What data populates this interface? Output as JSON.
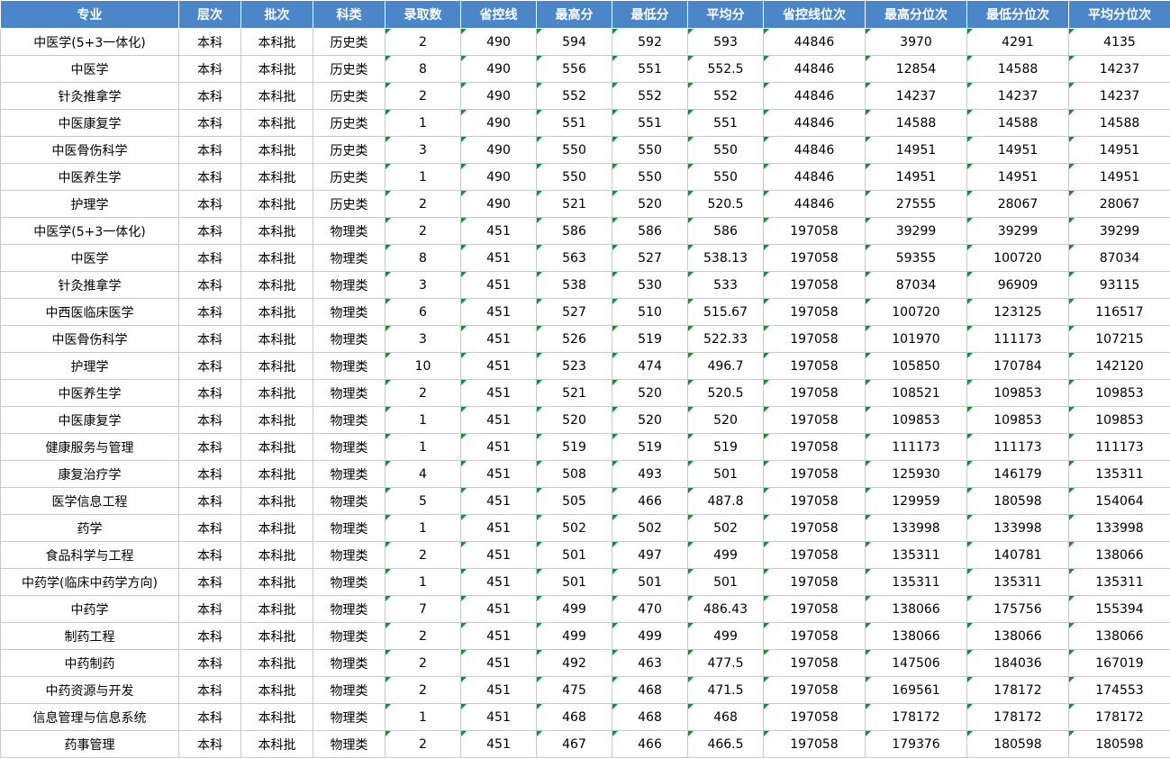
{
  "headers": [
    "专业",
    "层次",
    "批次",
    "科类",
    "录取数",
    "省控线",
    "最高分",
    "最低分",
    "平均分",
    "省控线位次",
    "最高分位次",
    "最低分位次",
    "平均分位次"
  ],
  "rows": [
    [
      "中医学(5+3一体化)",
      "本科",
      "本科批",
      "历史类",
      "2",
      "490",
      "594",
      "592",
      "593",
      "44846",
      "3970",
      "4291",
      "4135"
    ],
    [
      "中医学",
      "本科",
      "本科批",
      "历史类",
      "8",
      "490",
      "556",
      "551",
      "552.5",
      "44846",
      "12854",
      "14588",
      "14237"
    ],
    [
      "针灸推拿学",
      "本科",
      "本科批",
      "历史类",
      "2",
      "490",
      "552",
      "552",
      "552",
      "44846",
      "14237",
      "14237",
      "14237"
    ],
    [
      "中医康复学",
      "本科",
      "本科批",
      "历史类",
      "1",
      "490",
      "551",
      "551",
      "551",
      "44846",
      "14588",
      "14588",
      "14588"
    ],
    [
      "中医骨伤科学",
      "本科",
      "本科批",
      "历史类",
      "3",
      "490",
      "550",
      "550",
      "550",
      "44846",
      "14951",
      "14951",
      "14951"
    ],
    [
      "中医养生学",
      "本科",
      "本科批",
      "历史类",
      "1",
      "490",
      "550",
      "550",
      "550",
      "44846",
      "14951",
      "14951",
      "14951"
    ],
    [
      "护理学",
      "本科",
      "本科批",
      "历史类",
      "2",
      "490",
      "521",
      "520",
      "520.5",
      "44846",
      "27555",
      "28067",
      "28067"
    ],
    [
      "中医学(5+3一体化)",
      "本科",
      "本科批",
      "物理类",
      "2",
      "451",
      "586",
      "586",
      "586",
      "197058",
      "39299",
      "39299",
      "39299"
    ],
    [
      "中医学",
      "本科",
      "本科批",
      "物理类",
      "8",
      "451",
      "563",
      "527",
      "538.13",
      "197058",
      "59355",
      "100720",
      "87034"
    ],
    [
      "针灸推拿学",
      "本科",
      "本科批",
      "物理类",
      "3",
      "451",
      "538",
      "530",
      "533",
      "197058",
      "87034",
      "96909",
      "93115"
    ],
    [
      "中西医临床医学",
      "本科",
      "本科批",
      "物理类",
      "6",
      "451",
      "527",
      "510",
      "515.67",
      "197058",
      "100720",
      "123125",
      "116517"
    ],
    [
      "中医骨伤科学",
      "本科",
      "本科批",
      "物理类",
      "3",
      "451",
      "526",
      "519",
      "522.33",
      "197058",
      "101970",
      "111173",
      "107215"
    ],
    [
      "护理学",
      "本科",
      "本科批",
      "物理类",
      "10",
      "451",
      "523",
      "474",
      "496.7",
      "197058",
      "105850",
      "170784",
      "142120"
    ],
    [
      "中医养生学",
      "本科",
      "本科批",
      "物理类",
      "2",
      "451",
      "521",
      "520",
      "520.5",
      "197058",
      "108521",
      "109853",
      "109853"
    ],
    [
      "中医康复学",
      "本科",
      "本科批",
      "物理类",
      "1",
      "451",
      "520",
      "520",
      "520",
      "197058",
      "109853",
      "109853",
      "109853"
    ],
    [
      "健康服务与管理",
      "本科",
      "本科批",
      "物理类",
      "1",
      "451",
      "519",
      "519",
      "519",
      "197058",
      "111173",
      "111173",
      "111173"
    ],
    [
      "康复治疗学",
      "本科",
      "本科批",
      "物理类",
      "4",
      "451",
      "508",
      "493",
      "501",
      "197058",
      "125930",
      "146179",
      "135311"
    ],
    [
      "医学信息工程",
      "本科",
      "本科批",
      "物理类",
      "5",
      "451",
      "505",
      "466",
      "487.8",
      "197058",
      "129959",
      "180598",
      "154064"
    ],
    [
      "药学",
      "本科",
      "本科批",
      "物理类",
      "1",
      "451",
      "502",
      "502",
      "502",
      "197058",
      "133998",
      "133998",
      "133998"
    ],
    [
      "食品科学与工程",
      "本科",
      "本科批",
      "物理类",
      "2",
      "451",
      "501",
      "497",
      "499",
      "197058",
      "135311",
      "140781",
      "138066"
    ],
    [
      "中药学(临床中药学方向)",
      "本科",
      "本科批",
      "物理类",
      "1",
      "451",
      "501",
      "501",
      "501",
      "197058",
      "135311",
      "135311",
      "135311"
    ],
    [
      "中药学",
      "本科",
      "本科批",
      "物理类",
      "7",
      "451",
      "499",
      "470",
      "486.43",
      "197058",
      "138066",
      "175756",
      "155394"
    ],
    [
      "制药工程",
      "本科",
      "本科批",
      "物理类",
      "2",
      "451",
      "499",
      "499",
      "499",
      "197058",
      "138066",
      "138066",
      "138066"
    ],
    [
      "中药制药",
      "本科",
      "本科批",
      "物理类",
      "2",
      "451",
      "492",
      "463",
      "477.5",
      "197058",
      "147506",
      "184036",
      "167019"
    ],
    [
      "中药资源与开发",
      "本科",
      "本科批",
      "物理类",
      "2",
      "451",
      "475",
      "468",
      "471.5",
      "197058",
      "169561",
      "178172",
      "174553"
    ],
    [
      "信息管理与信息系统",
      "本科",
      "本科批",
      "物理类",
      "1",
      "451",
      "468",
      "468",
      "468",
      "197058",
      "178172",
      "178172",
      "178172"
    ],
    [
      "药事管理",
      "本科",
      "本科批",
      "物理类",
      "2",
      "451",
      "467",
      "466",
      "466.5",
      "197058",
      "179376",
      "180598",
      "180598"
    ]
  ]
}
